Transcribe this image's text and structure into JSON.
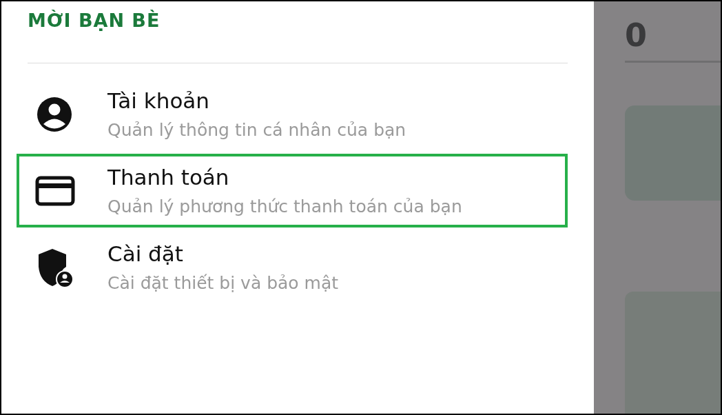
{
  "drawer": {
    "header": "MỜI BẠN BÈ",
    "items": [
      {
        "kind": "account",
        "title": "Tài khoản",
        "subtitle": "Quản lý thông tin cá nhân của bạn",
        "highlighted": false
      },
      {
        "kind": "payment",
        "title": "Thanh toán",
        "subtitle": "Quản lý phương thức thanh toán của bạn",
        "highlighted": true
      },
      {
        "kind": "settings",
        "title": "Cài đặt",
        "subtitle": "Cài đặt thiết bị và bảo mật",
        "highlighted": false
      }
    ]
  },
  "background": {
    "count": "0"
  }
}
